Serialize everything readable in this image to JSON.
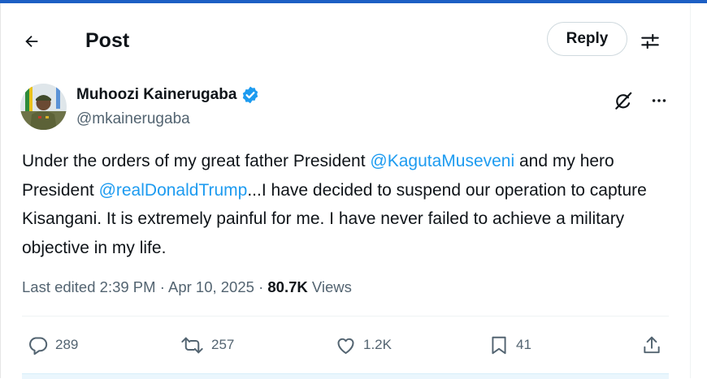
{
  "header": {
    "title": "Post",
    "reply_label": "Reply"
  },
  "author": {
    "name": "Muhoozi Kainerugaba",
    "handle": "@mkainerugaba"
  },
  "post": {
    "segments": [
      {
        "text": "Under the orders of my great father President ",
        "mention": false
      },
      {
        "text": "@KagutaMuseveni",
        "mention": true
      },
      {
        "text": " and my hero President ",
        "mention": false
      },
      {
        "text": "@realDonaldTrump",
        "mention": true
      },
      {
        "text": "...I have decided to suspend our operation to capture Kisangani. It is extremely painful for me. I have never failed to achieve a military objective in my life.",
        "mention": false
      }
    ]
  },
  "meta": {
    "edited": "Last edited 2:39 PM",
    "sep": " · ",
    "date": "Apr 10, 2025",
    "views_count": "80.7K",
    "views_label": "Views"
  },
  "actions": {
    "replies": "289",
    "reposts": "257",
    "likes": "1.2K",
    "bookmarks": "41"
  },
  "icons": [
    "back-arrow-icon",
    "adjust-icon",
    "verified-badge-icon",
    "grok-icon",
    "more-icon",
    "reply-icon",
    "repost-icon",
    "like-icon",
    "bookmark-icon",
    "share-icon"
  ],
  "colors": {
    "accent": "#1d9bf0",
    "text": "#0f1419",
    "muted": "#536471",
    "border": "#cfd9de",
    "top_bar": "#1d5fc4"
  }
}
